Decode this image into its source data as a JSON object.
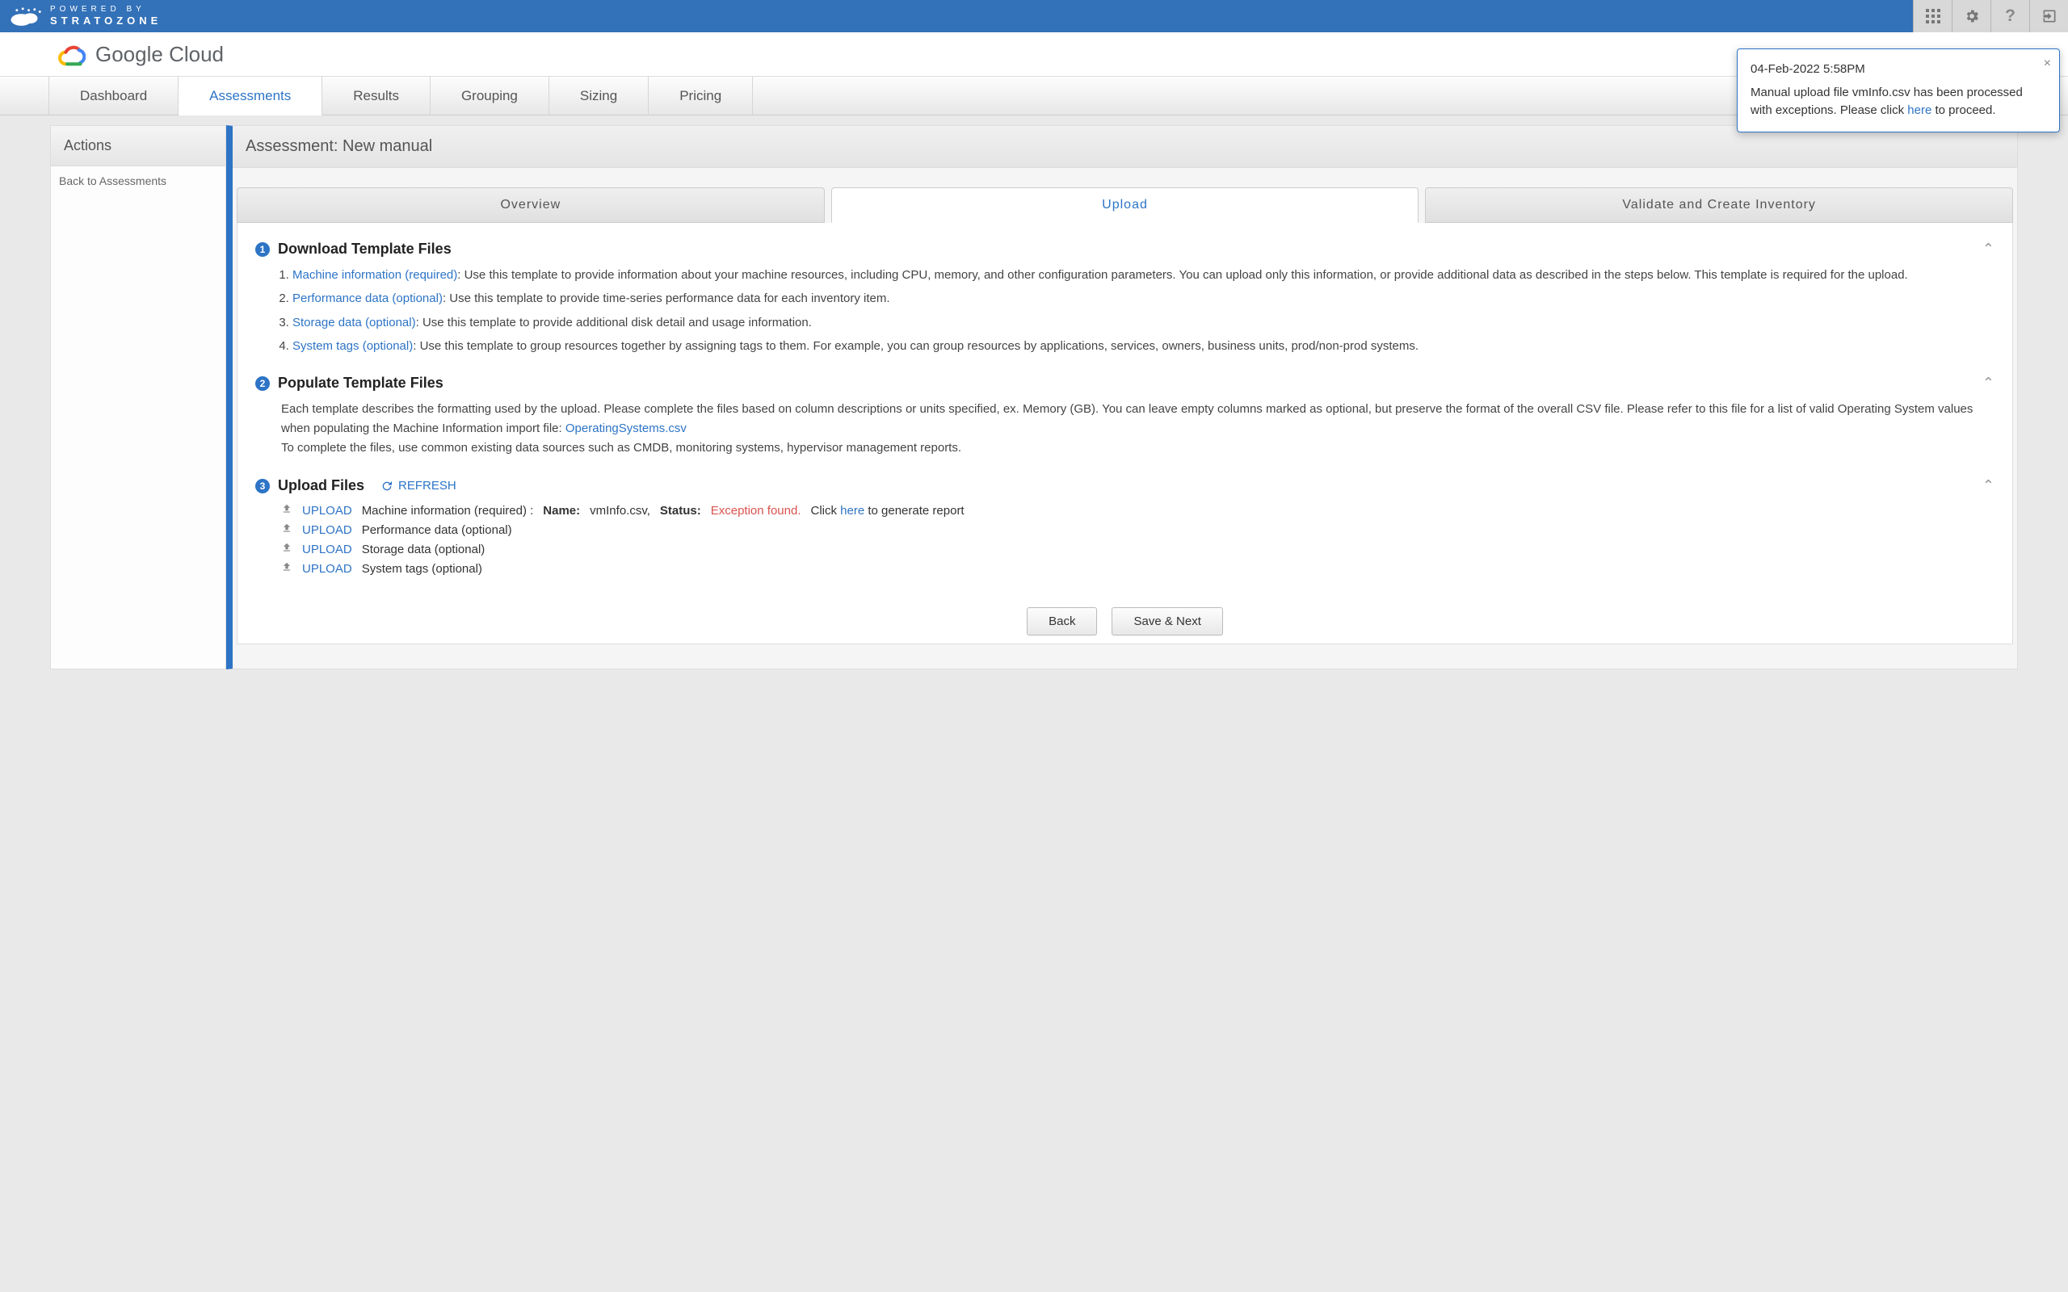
{
  "topbar": {
    "powered_by": "POWERED BY",
    "brand": "STRATOZONE"
  },
  "header": {
    "brand_bold": "Google",
    "brand_light": " Cloud"
  },
  "nav": {
    "items": [
      "Dashboard",
      "Assessments",
      "Results",
      "Grouping",
      "Sizing",
      "Pricing"
    ],
    "active_index": 1
  },
  "sidebar": {
    "title": "Actions",
    "back_link": "Back to Assessments"
  },
  "content": {
    "title": "Assessment: New manual",
    "subtabs": [
      "Overview",
      "Upload",
      "Validate and Create Inventory"
    ],
    "subtab_active_index": 1
  },
  "section1": {
    "num": "1",
    "title": "Download Template Files",
    "items": [
      {
        "link": "Machine information (required)",
        "text": ": Use this template to provide information about your machine resources, including CPU, memory, and other configuration parameters. You can upload only this information, or provide additional data as described in the steps below. This template is required for the upload."
      },
      {
        "link": "Performance data (optional)",
        "text": ": Use this template to provide time-series performance data for each inventory item."
      },
      {
        "link": "Storage data (optional)",
        "text": ": Use this template to provide additional disk detail and usage information."
      },
      {
        "link": "System tags (optional)",
        "text": ": Use this template to group resources together by assigning tags to them. For example, you can group resources by applications, services, owners, business units, prod/non-prod systems."
      }
    ]
  },
  "section2": {
    "num": "2",
    "title": "Populate Template Files",
    "body_pre": "Each template describes the formatting used by the upload. Please complete the files based on column descriptions or units specified, ex. Memory (GB). You can leave empty columns marked as optional, but preserve the format of the overall CSV file. Please refer to this file for a list of valid Operating System values when populating the Machine Information import file: ",
    "body_link": "OperatingSystems.csv",
    "body_post": "To complete the files, use common existing data sources such as CMDB, monitoring systems, hypervisor management reports."
  },
  "section3": {
    "num": "3",
    "title": "Upload Files",
    "refresh": "REFRESH",
    "upload_label": "UPLOAD",
    "rows": [
      {
        "label": "Machine information (required) :",
        "name_key": "Name:",
        "name_val": "vmInfo.csv,",
        "status_key": "Status:",
        "status_val": "Exception found.",
        "tail_pre": "Click ",
        "tail_link": "here",
        "tail_post": " to generate report"
      },
      {
        "label": "Performance data (optional)"
      },
      {
        "label": "Storage data (optional)"
      },
      {
        "label": "System tags (optional)"
      }
    ]
  },
  "buttons": {
    "back": "Back",
    "save_next": "Save & Next"
  },
  "toast": {
    "time": "04-Feb-2022 5:58PM",
    "msg_pre": "Manual upload file vmInfo.csv has been processed with exceptions. Please click ",
    "msg_link": "here",
    "msg_post": " to proceed."
  }
}
